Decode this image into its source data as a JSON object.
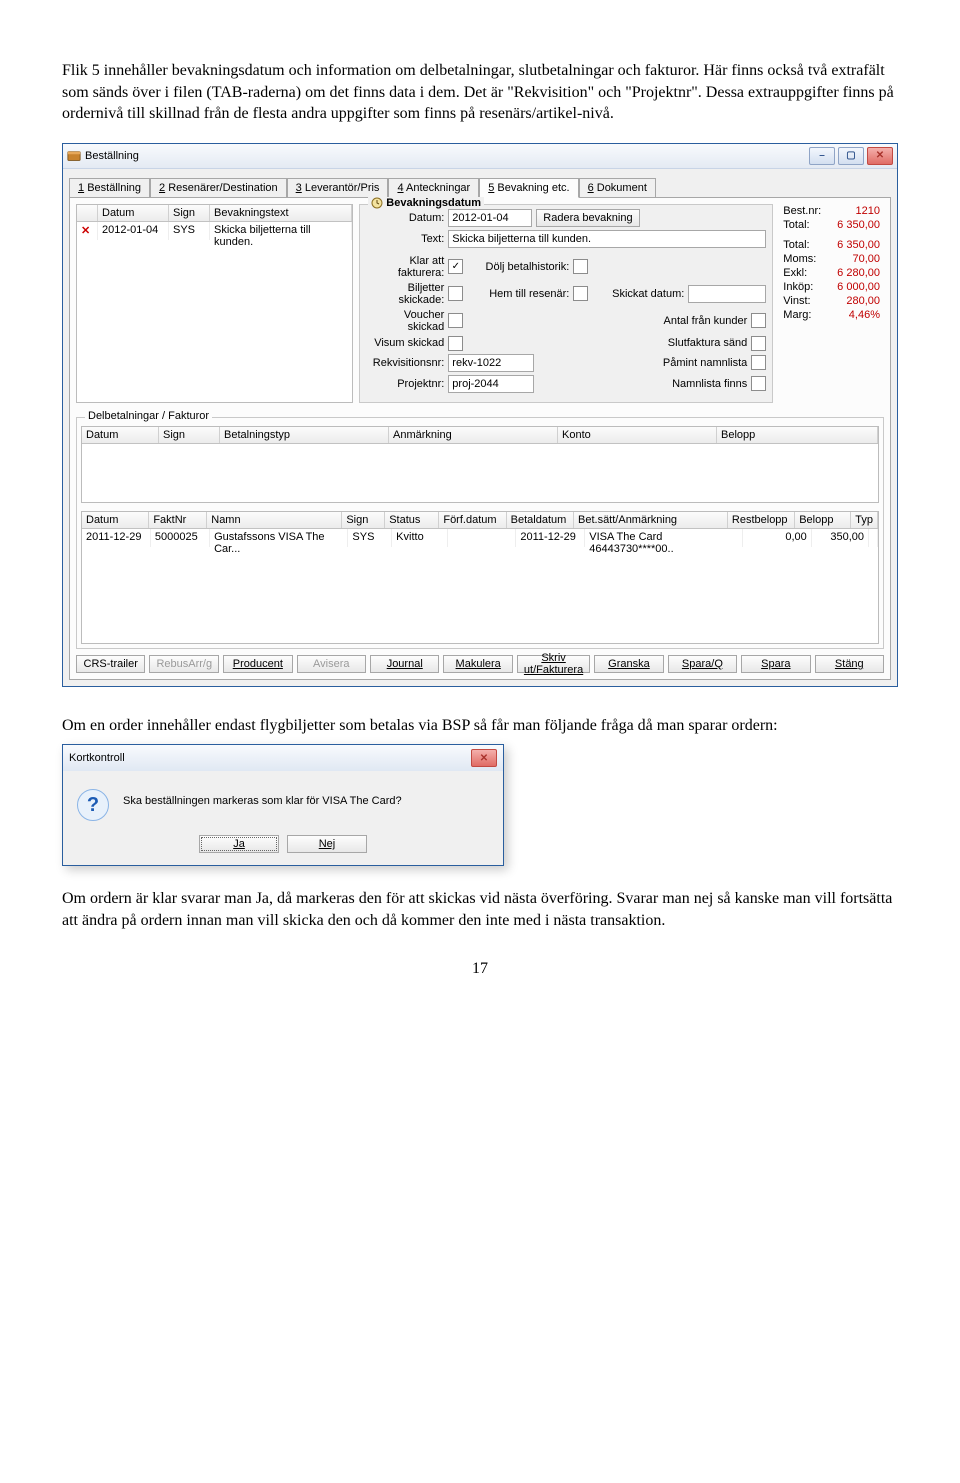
{
  "para1": "Flik 5 innehåller bevakningsdatum och information om delbetalningar, slutbetalningar och fakturor. Här finns också två extrafält som sänds över i filen (TAB-raderna) om det finns data i dem. Det är \"Rekvisition\" och \"Projektnr\". Dessa extrauppgifter finns på ordernivå till skillnad från de flesta andra uppgifter som finns på resenärs/artikel-nivå.",
  "para2": "Om en order innehåller endast flygbiljetter som betalas via BSP så får man följande fråga då man sparar ordern:",
  "para3": "Om ordern är klar svarar man Ja, då markeras den för att skickas vid nästa överföring. Svarar man nej så kanske man vill fortsätta att ändra på ordern innan man vill skicka den och då kommer den inte med i nästa transaktion.",
  "pageNum": "17",
  "win": {
    "title": "Beställning",
    "tabs": [
      "1 Beställning",
      "2 Resenärer/Destination",
      "3 Leverantör/Pris",
      "4 Anteckningar",
      "5 Bevakning etc.",
      "6 Dokument"
    ],
    "bevak": {
      "head": [
        "Datum",
        "Sign",
        "Bevakningstext"
      ],
      "row": [
        "2012-01-04",
        "SYS",
        "Skicka biljetterna till kunden."
      ]
    },
    "frame": {
      "title": "Bevakningsdatum",
      "datum_lbl": "Datum:",
      "datum_val": "2012-01-04",
      "radera_btn": "Radera bevakning",
      "text_lbl": "Text:",
      "text_val": "Skicka biljetterna till kunden.",
      "klar_lbl": "Klar att fakturera:",
      "dolj_lbl": "Dölj betalhistorik:",
      "biljetter_lbl": "Biljetter skickade:",
      "hem_lbl": "Hem till resenär:",
      "skickat_lbl": "Skickat datum:",
      "voucher_lbl": "Voucher skickad",
      "antal_lbl": "Antal från kunder",
      "visum_lbl": "Visum skickad",
      "slut_lbl": "Slutfaktura sänd",
      "rekv_lbl": "Rekvisitionsnr:",
      "rekv_val": "rekv-1022",
      "pamint_lbl": "Påmint namnlista",
      "proj_lbl": "Projektnr:",
      "proj_val": "proj-2044",
      "namn_lbl": "Namnlista finns"
    },
    "summary": {
      "bestnr_l": "Best.nr:",
      "bestnr_v": "1210",
      "total_l": "Total:",
      "total_v": "6 350,00",
      "total2_v": "6 350,00",
      "moms_l": "Moms:",
      "moms_v": "70,00",
      "exkl_l": "Exkl:",
      "exkl_v": "6 280,00",
      "inkop_l": "Inköp:",
      "inkop_v": "6 000,00",
      "vinst_l": "Vinst:",
      "vinst_v": "280,00",
      "marg_l": "Marg:",
      "marg_v": "4,46%"
    },
    "delbet": {
      "title": "Delbetalningar / Fakturor",
      "head1": [
        "Datum",
        "Sign",
        "Betalningstyp",
        "Anmärkning",
        "Konto",
        "Belopp"
      ],
      "head2": [
        "Datum",
        "FaktNr",
        "Namn",
        "Sign",
        "Status",
        "Förf.datum",
        "Betaldatum",
        "Bet.sätt/Anmärkning",
        "Restbelopp",
        "Belopp",
        "Typ"
      ],
      "row2": [
        "2011-12-29",
        "5000025",
        "Gustafssons VISA The Car...",
        "SYS",
        "Kvitto",
        "",
        "2011-12-29",
        "VISA The Card 46443730****00..",
        "0,00",
        "350,00",
        ""
      ]
    },
    "buttons": [
      "CRS-trailer",
      "RebusArr/g",
      "Producent",
      "Avisera",
      "Journal",
      "Makulera",
      "Skriv ut/Fakturera",
      "Granska",
      "Spara/Q",
      "Spara",
      "Stäng"
    ]
  },
  "dialog": {
    "title": "Kortkontroll",
    "msg": "Ska beställningen markeras som klar för VISA The Card?",
    "ja": "Ja",
    "nej": "Nej"
  }
}
